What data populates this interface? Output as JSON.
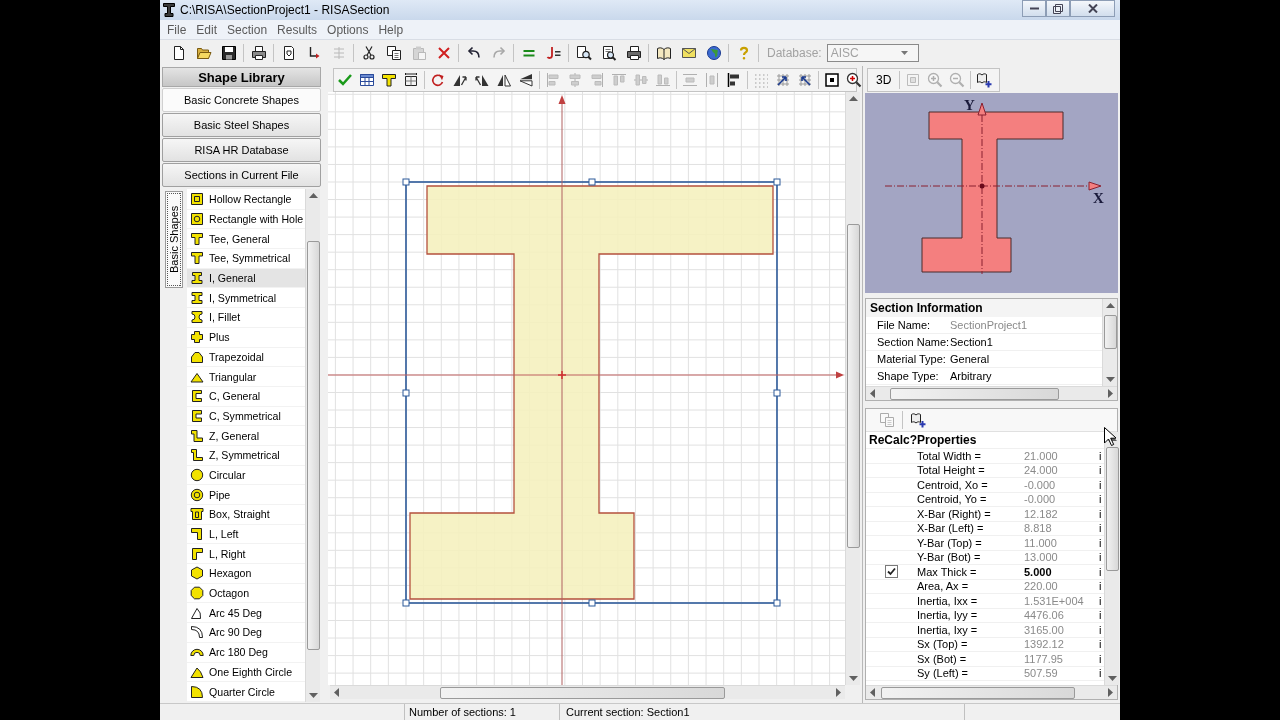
{
  "window": {
    "title": "C:\\RISA\\SectionProject1 - RISASection"
  },
  "menu": [
    "File",
    "Edit",
    "Section",
    "Results",
    "Options",
    "Help"
  ],
  "main_toolbar": [
    {
      "kind": "new",
      "disabled": false
    },
    {
      "kind": "open",
      "disabled": false
    },
    {
      "kind": "save",
      "disabled": false
    },
    {
      "kind": "separator"
    },
    {
      "kind": "print",
      "disabled": false
    },
    {
      "kind": "separator"
    },
    {
      "kind": "document",
      "disabled": false
    },
    {
      "kind": "relabel",
      "disabled": false
    },
    {
      "kind": "list",
      "disabled": true
    },
    {
      "kind": "separator"
    },
    {
      "kind": "cut",
      "disabled": false
    },
    {
      "kind": "copy",
      "disabled": false
    },
    {
      "kind": "paste",
      "disabled": true
    },
    {
      "kind": "delete",
      "disabled": false
    },
    {
      "kind": "separator"
    },
    {
      "kind": "undo",
      "disabled": false
    },
    {
      "kind": "redo",
      "disabled": true
    },
    {
      "kind": "separator"
    },
    {
      "kind": "equals",
      "disabled": false
    },
    {
      "kind": "hookequals",
      "disabled": false
    },
    {
      "kind": "separator"
    },
    {
      "kind": "find",
      "disabled": false
    },
    {
      "kind": "docsearch",
      "disabled": false
    },
    {
      "kind": "printer",
      "disabled": false
    },
    {
      "kind": "separator"
    },
    {
      "kind": "book",
      "disabled": false
    },
    {
      "kind": "mail",
      "disabled": false
    },
    {
      "kind": "globe",
      "disabled": false
    },
    {
      "kind": "separator"
    },
    {
      "kind": "help",
      "disabled": false
    },
    {
      "kind": "separator"
    }
  ],
  "database": {
    "label": "Database:",
    "value": "AISC",
    "disabled": true
  },
  "shape_library": {
    "title": "Shape Library",
    "categories": [
      {
        "label": "Basic Concrete Shapes",
        "selected": true
      },
      {
        "label": "Basic Steel Shapes",
        "selected": false
      },
      {
        "label": "RISA HR Database",
        "selected": false
      },
      {
        "label": "Sections in Current File",
        "selected": false
      }
    ],
    "side_tab": "Basic Shapes",
    "shapes": [
      {
        "kind": "hollowrect",
        "label": "Hollow Rectangle",
        "selected": false
      },
      {
        "kind": "ringrect",
        "label": "Rectangle with Hole",
        "selected": false
      },
      {
        "kind": "tee",
        "label": "Tee, General",
        "selected": false
      },
      {
        "kind": "teesym",
        "label": "Tee, Symmetrical",
        "selected": false
      },
      {
        "kind": "igen",
        "label": "I, General",
        "selected": true
      },
      {
        "kind": "isym",
        "label": "I, Symmetrical",
        "selected": false
      },
      {
        "kind": "ifillet",
        "label": "I, Fillet",
        "selected": false
      },
      {
        "kind": "plus",
        "label": "Plus",
        "selected": false
      },
      {
        "kind": "trapezoid",
        "label": "Trapezoidal",
        "selected": false
      },
      {
        "kind": "triangle",
        "label": "Triangular",
        "selected": false
      },
      {
        "kind": "channel",
        "label": "C, General",
        "selected": false
      },
      {
        "kind": "channelsym",
        "label": "C, Symmetrical",
        "selected": false
      },
      {
        "kind": "zee",
        "label": "Z, General",
        "selected": false
      },
      {
        "kind": "zeesym",
        "label": "Z, Symmetrical",
        "selected": false
      },
      {
        "kind": "circle",
        "label": "Circular",
        "selected": false
      },
      {
        "kind": "pipe",
        "label": "Pipe",
        "selected": false
      },
      {
        "kind": "box",
        "label": "Box, Straight",
        "selected": false
      },
      {
        "kind": "lleft",
        "label": "L, Left",
        "selected": false
      },
      {
        "kind": "lright",
        "label": "L, Right",
        "selected": false
      },
      {
        "kind": "hexagon",
        "label": "Hexagon",
        "selected": false
      },
      {
        "kind": "octagon",
        "label": "Octagon",
        "selected": false
      },
      {
        "kind": "arc45",
        "label": "Arc 45 Deg",
        "selected": false
      },
      {
        "kind": "arc90",
        "label": "Arc 90 Deg",
        "selected": false
      },
      {
        "kind": "arc180",
        "label": "Arc 180 Deg",
        "selected": false
      },
      {
        "kind": "eighth",
        "label": "One Eighth Circle",
        "selected": false
      },
      {
        "kind": "quarter",
        "label": "Quarter Circle",
        "selected": false
      }
    ]
  },
  "canvas_toolbar": [
    {
      "kind": "check",
      "disabled": false
    },
    {
      "kind": "table",
      "disabled": false
    },
    {
      "kind": "tee",
      "disabled": false
    },
    {
      "kind": "frame",
      "disabled": false
    },
    {
      "kind": "separator"
    },
    {
      "kind": "rotate",
      "disabled": false
    },
    {
      "kind": "skewl",
      "disabled": false
    },
    {
      "kind": "skewr",
      "disabled": false
    },
    {
      "kind": "fliph",
      "disabled": false
    },
    {
      "kind": "flipv",
      "disabled": false
    },
    {
      "kind": "separator"
    },
    {
      "kind": "alignl",
      "disabled": true
    },
    {
      "kind": "alignc",
      "disabled": true
    },
    {
      "kind": "alignr",
      "disabled": true
    },
    {
      "kind": "alignt",
      "disabled": true
    },
    {
      "kind": "alignm",
      "disabled": true
    },
    {
      "kind": "alignb",
      "disabled": true
    },
    {
      "kind": "separator"
    },
    {
      "kind": "distv",
      "disabled": true
    },
    {
      "kind": "disth",
      "disabled": true
    },
    {
      "kind": "alignedge",
      "disabled": false
    },
    {
      "kind": "separator"
    },
    {
      "kind": "dots",
      "disabled": true
    },
    {
      "kind": "snapgrid",
      "disabled": false
    },
    {
      "kind": "snappoint",
      "disabled": false
    },
    {
      "kind": "separator"
    },
    {
      "kind": "fitframe",
      "disabled": false
    },
    {
      "kind": "zoomin",
      "disabled": false
    }
  ],
  "preview_toolbar": [
    {
      "kind": "label",
      "label": "3D"
    },
    {
      "kind": "separator"
    },
    {
      "kind": "fit",
      "disabled": true
    },
    {
      "kind": "zoomin",
      "disabled": true
    },
    {
      "kind": "zoomout",
      "disabled": true
    },
    {
      "kind": "separator"
    },
    {
      "kind": "bookadd",
      "disabled": false
    }
  ],
  "preview": {
    "x_label": "X",
    "y_label": "Y"
  },
  "section_information": {
    "title": "Section Information",
    "rows": [
      {
        "label": "File Name:",
        "value": "SectionProject1",
        "disabled": true
      },
      {
        "label": "Section Name:",
        "value": "Section1",
        "disabled": false
      },
      {
        "label": "Material Type:",
        "value": "General",
        "disabled": false
      },
      {
        "label": "Shape Type:",
        "value": "Arbitrary",
        "disabled": false
      }
    ]
  },
  "properties_toolbar": [
    {
      "kind": "copy",
      "disabled": true
    },
    {
      "kind": "separator"
    },
    {
      "kind": "bookadd",
      "disabled": false
    }
  ],
  "properties": {
    "columns": [
      "ReCalc?",
      "Properties"
    ],
    "rows": [
      {
        "kind": "computed",
        "label": "Total Width =",
        "value": "21.000",
        "unit": "i"
      },
      {
        "kind": "computed",
        "label": "Total Height =",
        "value": "24.000",
        "unit": "i"
      },
      {
        "kind": "computed",
        "label": "Centroid, Xo =",
        "value": "-0.000",
        "unit": "i"
      },
      {
        "kind": "computed",
        "label": "Centroid, Yo =",
        "value": "-0.000",
        "unit": "i"
      },
      {
        "kind": "computed",
        "label": "X-Bar (Right) =",
        "value": "12.182",
        "unit": "i"
      },
      {
        "kind": "computed",
        "label": "X-Bar (Left) =",
        "value": "8.818",
        "unit": "i"
      },
      {
        "kind": "computed",
        "label": "Y-Bar (Top) =",
        "value": "11.000",
        "unit": "i"
      },
      {
        "kind": "computed",
        "label": "Y-Bar (Bot) =",
        "value": "13.000",
        "unit": "i"
      },
      {
        "kind": "input",
        "label": "Max Thick =",
        "value": "5.000",
        "unit": "i",
        "recalc": {
          "checked": true
        }
      },
      {
        "kind": "computed",
        "label": "Area, Ax =",
        "value": "220.00",
        "unit": "i"
      },
      {
        "kind": "computed",
        "label": "Inertia, Ixx =",
        "value": "1.531E+004",
        "unit": "i"
      },
      {
        "kind": "computed",
        "label": "Inertia, Iyy =",
        "value": "4476.06",
        "unit": "i"
      },
      {
        "kind": "computed",
        "label": "Inertia, Ixy =",
        "value": "3165.00",
        "unit": "i"
      },
      {
        "kind": "computed",
        "label": "Sx (Top) =",
        "value": "1392.12",
        "unit": "i"
      },
      {
        "kind": "computed",
        "label": "Sx (Bot) =",
        "value": "1177.95",
        "unit": "i"
      },
      {
        "kind": "computed",
        "label": "Sy (Left) =",
        "value": "507.59",
        "unit": "i"
      }
    ]
  },
  "status_bar": [
    "Number of sections: 1",
    "Current section: Section1"
  ]
}
